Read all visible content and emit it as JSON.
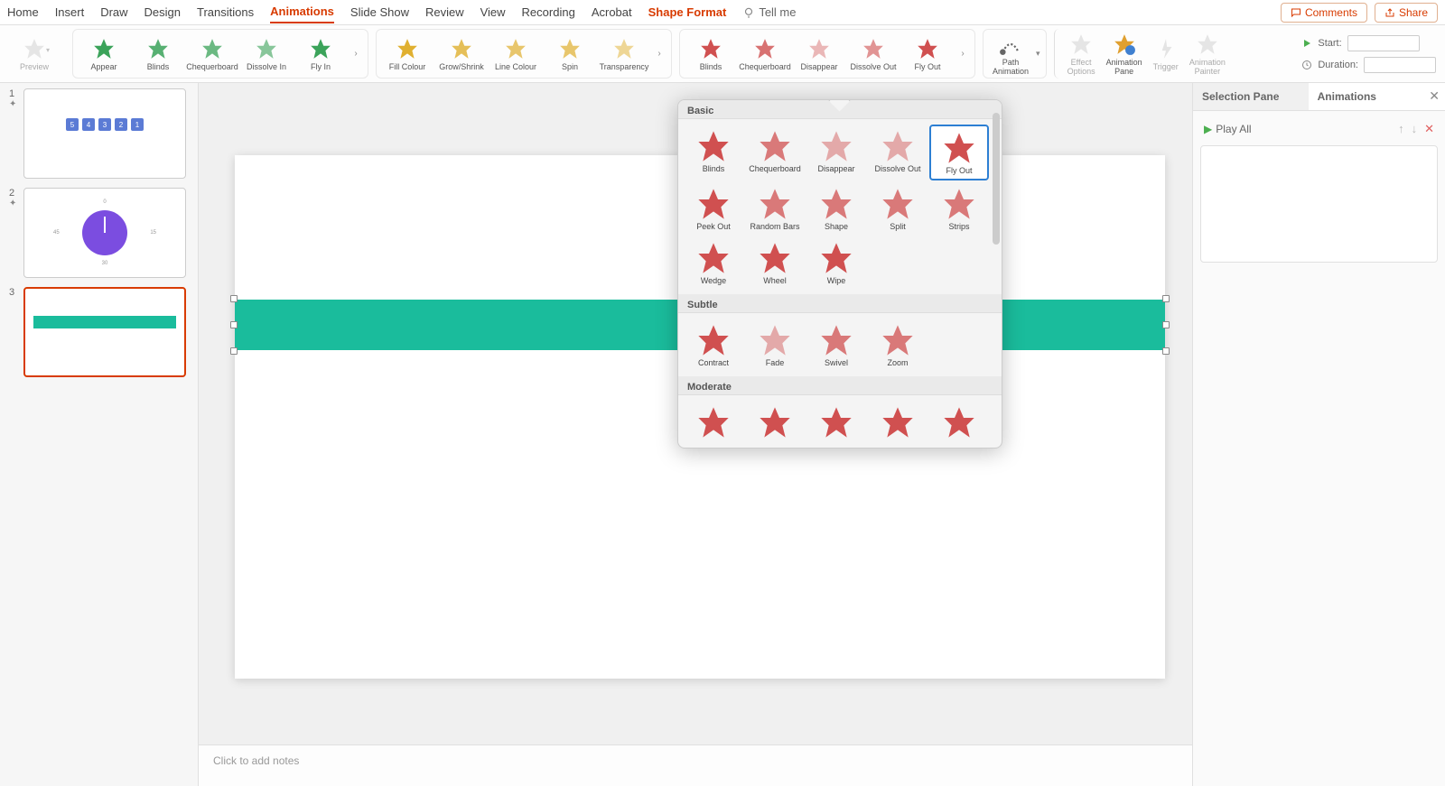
{
  "tabs": [
    "Home",
    "Insert",
    "Draw",
    "Design",
    "Transitions",
    "Animations",
    "Slide Show",
    "Review",
    "View",
    "Recording",
    "Acrobat",
    "Shape Format"
  ],
  "active_tab": "Animations",
  "tellme": "Tell me",
  "header_buttons": {
    "comments": "Comments",
    "share": "Share"
  },
  "ribbon": {
    "preview": "Preview",
    "entrance": [
      "Appear",
      "Blinds",
      "Chequerboard",
      "Dissolve In",
      "Fly In"
    ],
    "emphasis": [
      "Fill Colour",
      "Grow/Shrink",
      "Line Colour",
      "Spin",
      "Transparency"
    ],
    "exit": [
      "Blinds",
      "Chequerboard",
      "Disappear",
      "Dissolve Out",
      "Fly Out"
    ],
    "path": {
      "label_l1": "Path",
      "label_l2": "Animation"
    },
    "effect_options": {
      "l1": "Effect",
      "l2": "Options"
    },
    "animation_pane": {
      "l1": "Animation",
      "l2": "Pane"
    },
    "trigger": "Trigger",
    "animation_painter": {
      "l1": "Animation",
      "l2": "Painter"
    },
    "start_label": "Start:",
    "duration_label": "Duration:"
  },
  "slides": [
    {
      "num": "1",
      "type": "boxes",
      "boxes": [
        "5",
        "4",
        "3",
        "2",
        "1"
      ]
    },
    {
      "num": "2",
      "type": "clock",
      "labels": [
        "0",
        "15",
        "30",
        "45"
      ]
    },
    {
      "num": "3",
      "type": "bar",
      "selected": true
    }
  ],
  "notes_placeholder": "Click to add notes",
  "sidepane": {
    "tabs": [
      "Selection Pane",
      "Animations"
    ],
    "active": "Selection Pane",
    "play_all": "Play All"
  },
  "gallery": {
    "sections": [
      {
        "title": "Basic",
        "items": [
          "Blinds",
          "Chequerboard",
          "Disappear",
          "Dissolve Out",
          "Fly Out",
          "Peek Out",
          "Random Bars",
          "Shape",
          "Split",
          "Strips",
          "Wedge",
          "Wheel",
          "Wipe"
        ],
        "selected": "Fly Out"
      },
      {
        "title": "Subtle",
        "items": [
          "Contract",
          "Fade",
          "Swivel",
          "Zoom"
        ]
      },
      {
        "title": "Moderate",
        "items": [
          "",
          "",
          "",
          "",
          ""
        ]
      }
    ]
  }
}
